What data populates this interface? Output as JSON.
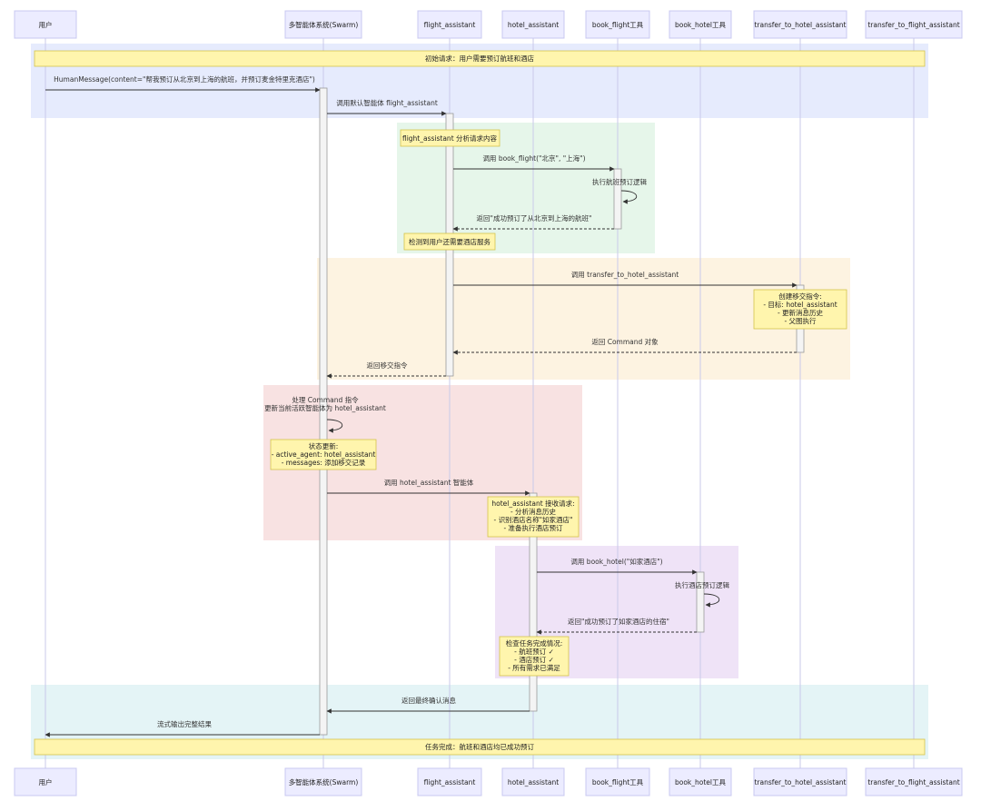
{
  "participants": [
    {
      "id": "user",
      "label": "用户"
    },
    {
      "id": "swarm",
      "label": "多智能体系统(Swarm)"
    },
    {
      "id": "flight",
      "label": "flight_assistant"
    },
    {
      "id": "hotel",
      "label": "hotel_assistant"
    },
    {
      "id": "book_flight",
      "label": "book_flight工具"
    },
    {
      "id": "book_hotel",
      "label": "book_hotel工具"
    },
    {
      "id": "transfer_hotel",
      "label": "transfer_to_hotel_assistant"
    },
    {
      "id": "transfer_flight",
      "label": "transfer_to_flight_assistant"
    }
  ],
  "messages": [
    {
      "text": "HumanMessage(content=\"帮我预订从北京到上海的航班，并预订麦金特里克酒店\")",
      "from": "user",
      "to": "swarm",
      "style": "solid"
    },
    {
      "text": "调用默认智能体 flight_assistant",
      "from": "swarm",
      "to": "flight",
      "style": "solid"
    },
    {
      "text": "调用 book_flight(\"北京\", \"上海\")",
      "from": "flight",
      "to": "book_flight",
      "style": "solid"
    },
    {
      "text": "执行航班预订逻辑",
      "from": "book_flight",
      "to": "book_flight",
      "style": "self"
    },
    {
      "text": "返回\"成功预订了从北京到上海的航班\"",
      "from": "book_flight",
      "to": "flight",
      "style": "dashed"
    },
    {
      "text": "调用 transfer_to_hotel_assistant",
      "from": "flight",
      "to": "transfer_hotel",
      "style": "solid"
    },
    {
      "text": "返回 Command 对象",
      "from": "transfer_hotel",
      "to": "flight",
      "style": "dashed"
    },
    {
      "text": "返回移交指令",
      "from": "flight",
      "to": "swarm",
      "style": "dashed"
    },
    {
      "text": "处理 Command 指令",
      "from": "swarm",
      "to": "swarm",
      "style": "self"
    },
    {
      "text": "更新当前活跃智能体为 hotel_assistant",
      "from": "swarm",
      "to": "swarm",
      "style": "self"
    },
    {
      "text": "调用 hotel_assistant 智能体",
      "from": "swarm",
      "to": "hotel",
      "style": "solid"
    },
    {
      "text": "调用 book_hotel(\"如家酒店\")",
      "from": "hotel",
      "to": "book_hotel",
      "style": "solid"
    },
    {
      "text": "执行酒店预订逻辑",
      "from": "book_hotel",
      "to": "book_hotel",
      "style": "self"
    },
    {
      "text": "返回\"成功预订了如家酒店的住宿\"",
      "from": "book_hotel",
      "to": "hotel",
      "style": "dashed"
    },
    {
      "text": "返回最终确认消息",
      "from": "hotel",
      "to": "swarm",
      "style": "solid"
    },
    {
      "text": "流式输出完整结果",
      "from": "swarm",
      "to": "user",
      "style": "solid"
    }
  ],
  "notes": [
    {
      "name": "note-initial-request",
      "lines": [
        "初始请求：用户需要预订航班和酒店"
      ]
    },
    {
      "name": "note-flight-analyze",
      "lines": [
        "flight_assistant 分析请求内容"
      ]
    },
    {
      "name": "note-detect-hotel",
      "lines": [
        "检测到用户还需要酒店服务"
      ]
    },
    {
      "name": "note-create-transfer",
      "lines": [
        "创建移交指令:",
        "- 目标: hotel_assistant",
        "- 更新消息历史",
        "- 父图执行"
      ]
    },
    {
      "name": "note-state-update",
      "lines": [
        "状态更新:",
        "- active_agent: hotel_assistant",
        "- messages: 添加移交记录"
      ]
    },
    {
      "name": "note-hotel-receive",
      "lines": [
        "hotel_assistant 接收请求:",
        "- 分析消息历史",
        "- 识别酒店名称\"如家酒店\"",
        "- 准备执行酒店预订"
      ]
    },
    {
      "name": "note-check-complete",
      "lines": [
        "检查任务完成情况:",
        "- 航班预订 ✓",
        "- 酒店预订 ✓",
        "- 所有需求已满足"
      ]
    },
    {
      "name": "note-task-complete",
      "lines": [
        "任务完成：航班和酒店均已成功预订"
      ]
    }
  ],
  "colors": {
    "participant_fill": "#ECECFF",
    "participant_stroke": "#c8c8f0",
    "lifeline": "#c9c9ea",
    "arrow": "#333333",
    "note_fill": "#fff5ad",
    "note_stroke": "#d4c44a",
    "activation_fill": "#f4f4f4",
    "activation_stroke": "#999999",
    "band_initial": "#e6ebfd",
    "band_flight_tool": "#e6f6ea",
    "band_transfer": "#fdf3e1",
    "band_command": "#f8e2e2",
    "band_hotel_tool": "#efe3f7",
    "band_final": "#e4f4f6"
  }
}
